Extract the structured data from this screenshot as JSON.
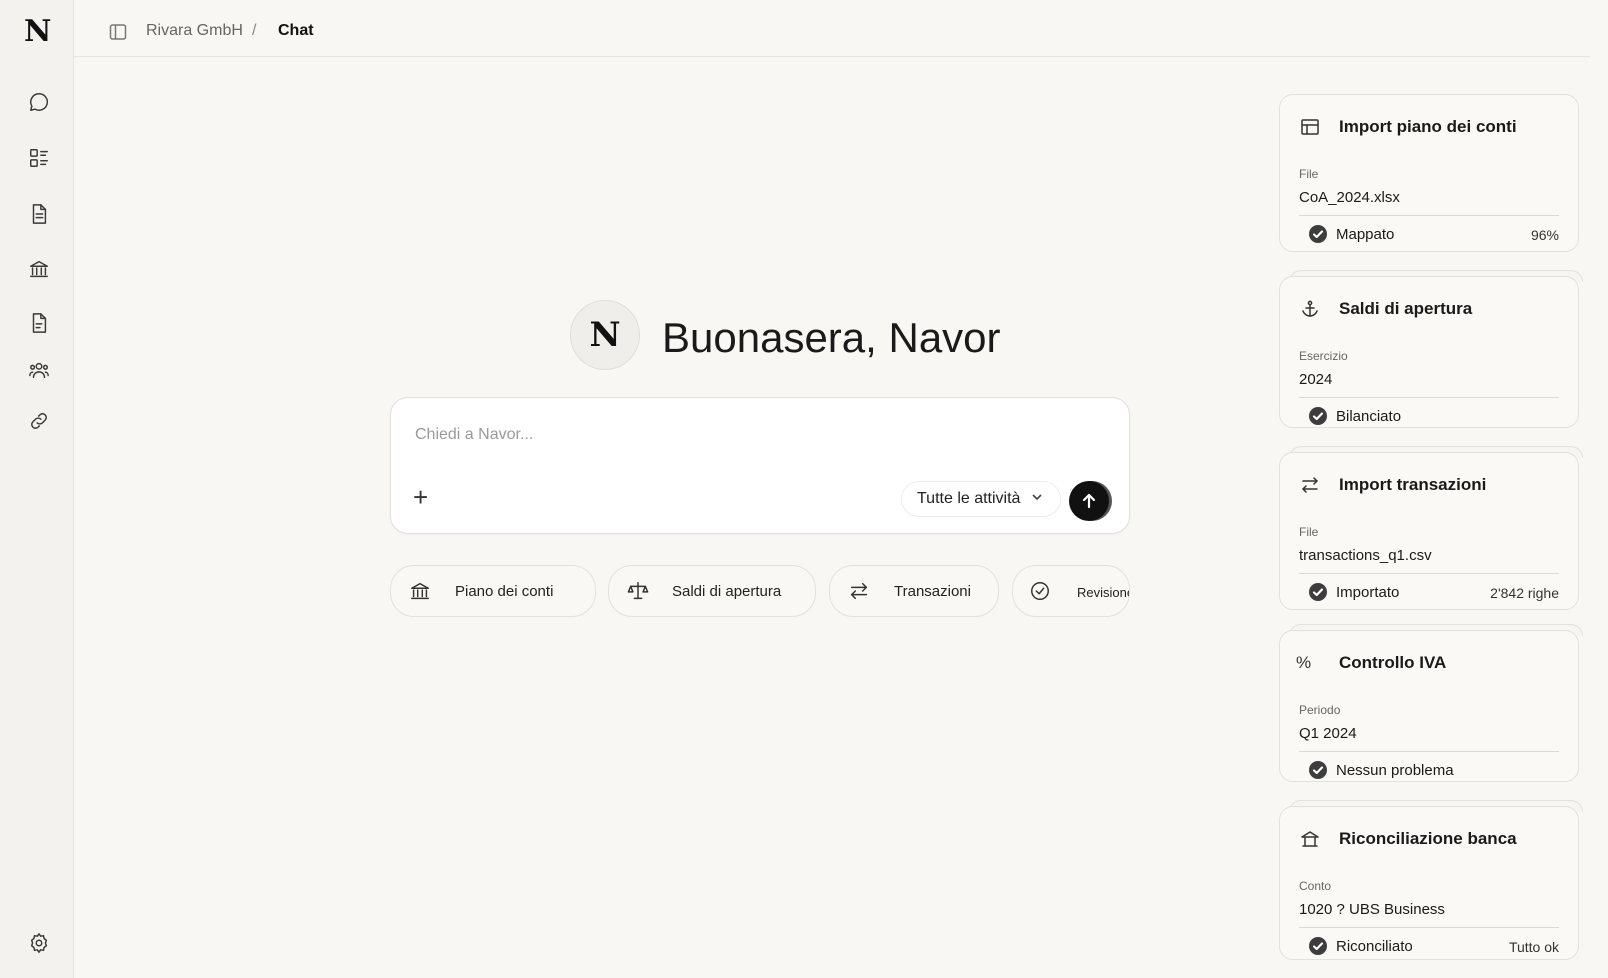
{
  "sidebar": {
    "logo": "N",
    "items": [
      {
        "name": "chat-icon"
      },
      {
        "name": "dashboard-icon"
      },
      {
        "name": "document-icon"
      },
      {
        "name": "bank-icon"
      },
      {
        "name": "file-text-icon"
      },
      {
        "name": "users-icon"
      },
      {
        "name": "link-icon"
      }
    ],
    "settings": "gear-icon"
  },
  "breadcrumb": {
    "org": "Rivara GmbH",
    "separator": "/",
    "current": "Chat"
  },
  "greeting": {
    "avatar_letter": "N",
    "text": "Buonasera, Navor"
  },
  "composer": {
    "placeholder": "Chiedi a Navor...",
    "value": "",
    "add_label": "+",
    "scope_select": "Tutte le attività"
  },
  "quick_actions": [
    {
      "label": "Piano dei conti",
      "icon": "bank-icon"
    },
    {
      "label": "Saldi di apertura",
      "icon": "scale-icon"
    },
    {
      "label": "Transazioni",
      "icon": "swap-icon"
    },
    {
      "label": "Revisione",
      "icon": "check-circle-icon"
    }
  ],
  "cards": [
    {
      "title": "Import piano dei conti",
      "icon": "table-icon",
      "field_label": "File",
      "field_value": "CoA_2024.xlsx",
      "status": "Mappato",
      "meta": "96%"
    },
    {
      "title": "Saldi di apertura",
      "icon": "anchor-icon",
      "field_label": "Esercizio",
      "field_value": "2024",
      "status": "Bilanciato",
      "meta": ""
    },
    {
      "title": "Import transazioni",
      "icon": "swap-icon",
      "field_label": "File",
      "field_value": "transactions_q1.csv",
      "status": "Importato",
      "meta": "2'842 righe"
    },
    {
      "title": "Controllo IVA",
      "icon": "percent-icon",
      "icon_text": "%",
      "field_label": "Periodo",
      "field_value": "Q1 2024",
      "status": "Nessun problema",
      "meta": ""
    },
    {
      "title": "Riconciliazione banca",
      "icon": "bank-building-icon",
      "field_label": "Conto",
      "field_value": "1020 ? UBS Business",
      "status": "Riconciliato",
      "meta": "Tutto ok"
    }
  ],
  "colors": {
    "background": "#f8f7f4",
    "sidebar": "#f3f2ee",
    "send_button": "#111111",
    "check": "#3d3d3d"
  }
}
